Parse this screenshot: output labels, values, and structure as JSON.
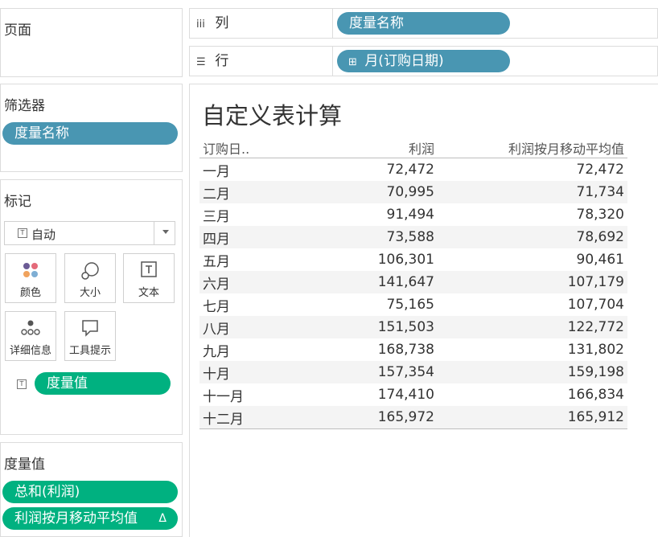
{
  "pages": {
    "title": "页面"
  },
  "shelves": {
    "columns": {
      "label": "列",
      "pill": "度量名称"
    },
    "rows": {
      "label": "行",
      "pill_icon": "⊞",
      "pill": "月(订购日期)"
    }
  },
  "filters": {
    "title": "筛选器",
    "pill": "度量名称"
  },
  "marks": {
    "title": "标记",
    "type_select": "自动",
    "buttons": [
      {
        "label": "颜色"
      },
      {
        "label": "大小"
      },
      {
        "label": "文本"
      },
      {
        "label": "详细信息"
      },
      {
        "label": "工具提示"
      }
    ],
    "text_pill": "度量值"
  },
  "measure_values": {
    "title": "度量值",
    "pills": [
      {
        "label": "总和(利润)"
      },
      {
        "label": "利润按月移动平均值",
        "icon": "Δ"
      }
    ]
  },
  "sheet": {
    "title": "自定义表计算",
    "columns": [
      "订购日..",
      "利润",
      "利润按月移动平均值"
    ],
    "rows": [
      [
        "一月",
        "72,472",
        "72,472"
      ],
      [
        "二月",
        "70,995",
        "71,734"
      ],
      [
        "三月",
        "91,494",
        "78,320"
      ],
      [
        "四月",
        "73,588",
        "78,692"
      ],
      [
        "五月",
        "106,301",
        "90,461"
      ],
      [
        "六月",
        "141,647",
        "107,179"
      ],
      [
        "七月",
        "75,165",
        "107,704"
      ],
      [
        "八月",
        "151,503",
        "122,772"
      ],
      [
        "九月",
        "168,738",
        "131,802"
      ],
      [
        "十月",
        "157,354",
        "159,198"
      ],
      [
        "十一月",
        "174,410",
        "166,834"
      ],
      [
        "十二月",
        "165,972",
        "165,912"
      ]
    ]
  },
  "colors": {
    "dimension_pill": "#4996b2",
    "measure_pill": "#00b180"
  }
}
